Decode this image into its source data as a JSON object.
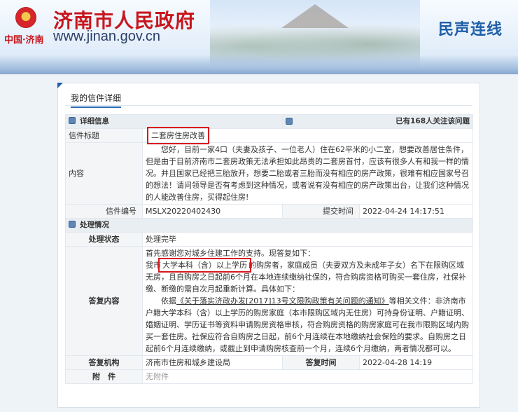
{
  "header": {
    "site_name": "济南市人民政府",
    "logo_text": "中国·济南",
    "url": "www.jinan.gov.cn",
    "channel": "民声连线"
  },
  "panel": {
    "title": "我的信件详细"
  },
  "detail": {
    "section_title": "详细信息",
    "follow_text": "已有168人关注该问题",
    "subject_label": "信件标题",
    "subject_value": "二套房住房改善",
    "content_label": "内容",
    "content_value": "您好，目前一家4口（夫妻及孩子、一位老人）住在62平米的小二室，想要改善居住条件，但是由于目前济南市二套房政策无法承担如此昂贵的二套房首付，应该有很多人有和我一样的情况。并且国家已经把三胎放开，想要二胎或者三胎而没有相应的房产政策，很难有相应国家号召的想法！请问领导是否有考虑到这种情况，或者说有没有相应的房产政策出台，让我们这种情况的人能改善住房，买得起住房!",
    "number_label": "信件编号",
    "number_value": "MSLX20220402430",
    "submit_time_label": "提交时间",
    "submit_time_value": "2022-04-24 14:17:51"
  },
  "process": {
    "section_title": "处理情况",
    "status_label": "处理状态",
    "status_value": "处理完毕",
    "reply_label": "答复内容",
    "reply_p1": "首先感谢您对城乡住建工作的支持。现答复如下：",
    "reply_p2_pre": "我市",
    "reply_p2_highlight": "大学本科（含）以上学历",
    "reply_p2_post": "的购房者，家庭成员（夫妻双方及未成年子女）名下在限购区域无房，且自购房之日起前6个月在本地连续缴纳社保的，符合购房资格可购买一套住房，社保补缴、断缴的需自次月起重新计算。具体如下：",
    "reply_p3_pre": "依据",
    "reply_p3_doc": "《关于落实济政办发[2017]13号文限购政策有关问题的通知》",
    "reply_p3_post": "等相关文件：非济南市户籍大学本科（含）以上学历的购房家庭（本市限购区域内无住房）可持身份证明、户籍证明、婚姻证明、学历证书等资料申请购房资格审核，符合购房资格的购房家庭可在我市限购区域内购买一套住房。社保应符合自购房之日起，前6个月连续在本地缴纳社会保险的要求。自购房之日起前6个月连续缴纳，或截止到申请购房核查前一个月，连续6个月缴纳，两者情况都可以。",
    "org_label": "答复机构",
    "org_value": "济南市住房和城乡建设局",
    "reply_time_label": "答复时间",
    "reply_time_value": "2022-04-28 14:19",
    "attach_label": "附　件",
    "attach_value": "无附件"
  }
}
